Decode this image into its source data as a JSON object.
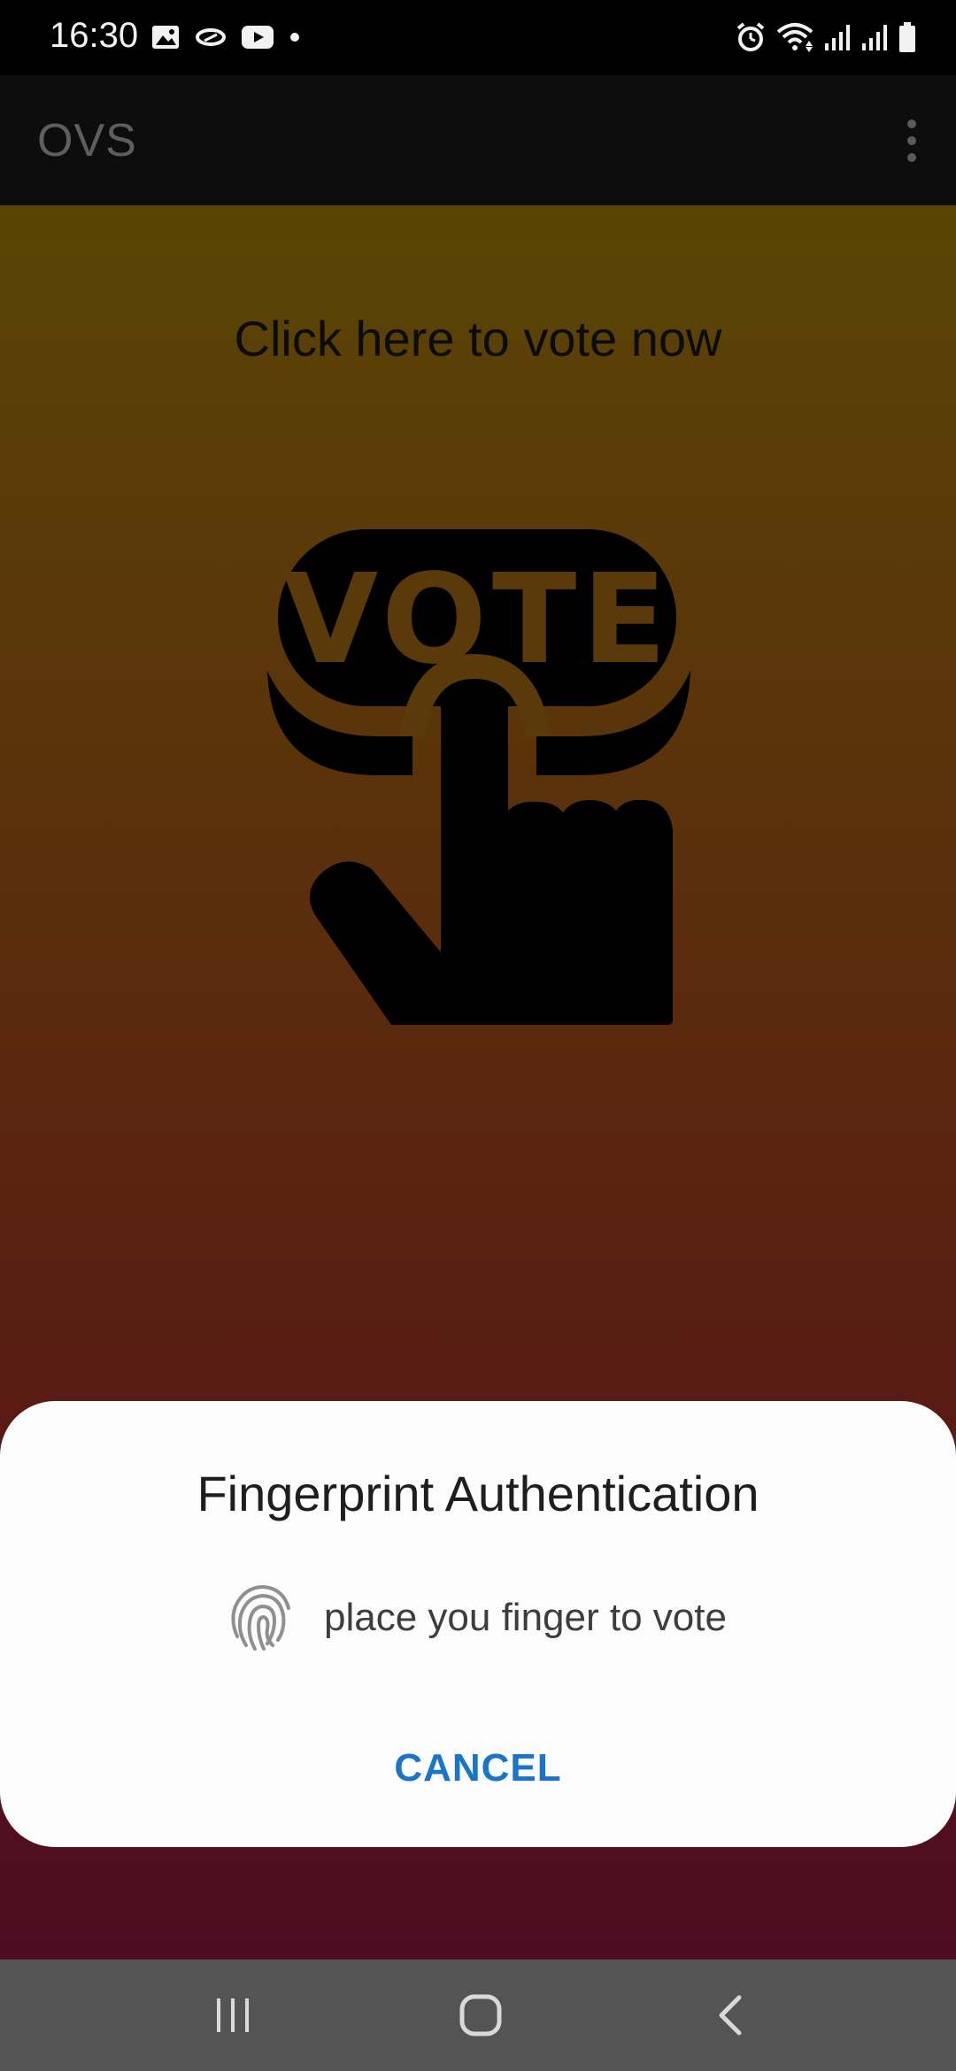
{
  "status_bar": {
    "time": "16:30",
    "left_icons": [
      "gallery-icon",
      "link-icon",
      "youtube-icon",
      "dot-icon"
    ],
    "right_icons": [
      "alarm-icon",
      "wifi-icon",
      "signal-icon",
      "signal-icon",
      "battery-icon"
    ]
  },
  "app_bar": {
    "title": "OVS",
    "menu_icon": "overflow-menu-icon"
  },
  "main": {
    "prompt": "Click here to vote now",
    "vote_image_text": "VOTE"
  },
  "dialog": {
    "title": "Fingerprint Authentication",
    "icon": "fingerprint-icon",
    "message": "place you finger to vote",
    "cancel_label": "CANCEL"
  },
  "nav_bar": {
    "buttons": [
      "recents-icon",
      "home-icon",
      "back-icon"
    ]
  },
  "colors": {
    "gradient_top": "#5a4505",
    "gradient_bottom": "#4d0c22",
    "accent": "#1a74c8",
    "dialog_bg": "#fcfcfc",
    "nav_bg": "#545454"
  }
}
